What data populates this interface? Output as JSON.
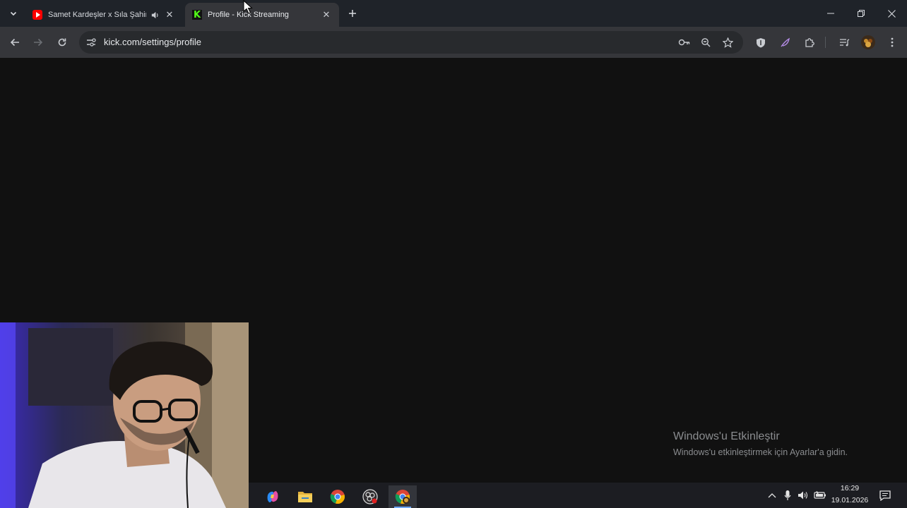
{
  "browser": {
    "tabs": [
      {
        "title": "Samet Kardeşler x Sıla Şahin",
        "favicon": "youtube-icon",
        "audio": true,
        "active": false
      },
      {
        "title": "Profile - Kick Streaming",
        "favicon": "kick-icon",
        "audio": false,
        "active": true
      }
    ],
    "url": "kick.com/settings/profile"
  },
  "watermark": {
    "title": "Windows'u Etkinleştir",
    "subtitle": "Windows'u etkinleştirmek için Ayarlar'a gidin."
  },
  "taskbar": {
    "apps": [
      "copilot-icon",
      "file-explorer-icon",
      "chrome-icon",
      "obs-icon",
      "chrome-profile-icon"
    ],
    "time": "16:29",
    "date": "19.01.2026"
  },
  "colors": {
    "page_background": "#111111",
    "tabstrip": "#1f2329",
    "toolbar": "#35363a",
    "kick_green": "#53fc18"
  }
}
